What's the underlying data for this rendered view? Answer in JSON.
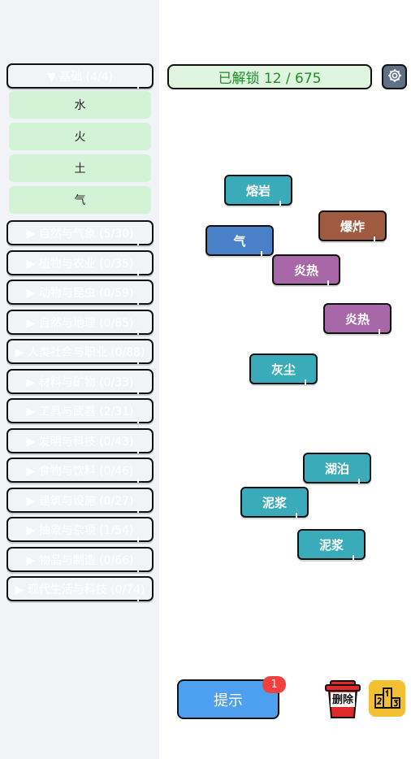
{
  "sidebar": {
    "categories": [
      {
        "label": "▼ 基础 (4/4)",
        "color": "#4a80c8"
      },
      {
        "label": "▶ 自然与气象 (5/30)",
        "color": "#3aabb8"
      },
      {
        "label": "▶ 植物与农业 (0/35)",
        "color": "#4cb050"
      },
      {
        "label": "▶ 动物与昆虫 (0/59)",
        "color": "#cc9a40"
      },
      {
        "label": "▶ 自然与地理 (0/85)",
        "color": "#8c6a48"
      },
      {
        "label": "▶ 人类社会与职业 (0/88)",
        "color": "#b85074"
      },
      {
        "label": "▶ 材料与矿物 (0/33)",
        "color": "#7d7aa4"
      },
      {
        "label": "▶ 工具与武器 (2/31)",
        "color": "#a05a40"
      },
      {
        "label": "▶ 发明与科技 (0/43)",
        "color": "#6a4cba"
      },
      {
        "label": "▶ 食物与饮料 (0/46)",
        "color": "#d37a3c"
      },
      {
        "label": "▶ 建筑与设施 (0/27)",
        "color": "#8cac40"
      },
      {
        "label": "▶ 抽象与杂项 (1/54)",
        "color": "#a868a8"
      },
      {
        "label": "▶ 物品与制造 (0/66)",
        "color": "#4e8c88"
      },
      {
        "label": "▶ 现代生活与科技 (0/74)",
        "color": "#3a78b8"
      }
    ],
    "basic_items": [
      "水",
      "火",
      "土",
      "气"
    ]
  },
  "header": {
    "unlocked_label": "已解锁 12 / 675"
  },
  "canvas": {
    "tiles": [
      {
        "label": "熔岩",
        "color": "#3aabb8"
      },
      {
        "label": "爆炸",
        "color": "#a05a40"
      },
      {
        "label": "气",
        "color": "#4a80c8"
      },
      {
        "label": "炎热",
        "color": "#a868a8"
      },
      {
        "label": "炎热",
        "color": "#a868a8"
      },
      {
        "label": "灰尘",
        "color": "#3aabb8"
      },
      {
        "label": "湖泊",
        "color": "#3aabb8"
      },
      {
        "label": "泥浆",
        "color": "#3aabb8"
      },
      {
        "label": "泥浆",
        "color": "#3aabb8"
      }
    ]
  },
  "footer": {
    "hint_label": "提示",
    "hint_count": "1",
    "delete_label": "删除",
    "settings_icon": "gear-icon",
    "trash_icon": "trash-icon",
    "leaderboard_icon": "podium-icon"
  }
}
